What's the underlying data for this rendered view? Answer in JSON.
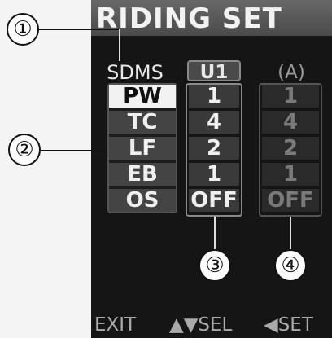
{
  "header": {
    "title": "RIDING SET"
  },
  "columns": {
    "row_header": "SDMS",
    "user_mode": "U1",
    "preset": "(A)"
  },
  "rows": [
    {
      "label": "PW",
      "user_value": "1",
      "preset_value": "1"
    },
    {
      "label": "TC",
      "user_value": "4",
      "preset_value": "4"
    },
    {
      "label": "LF",
      "user_value": "2",
      "preset_value": "2"
    },
    {
      "label": "EB",
      "user_value": "1",
      "preset_value": "1"
    },
    {
      "label": "OS",
      "user_value": "OFF",
      "preset_value": "OFF"
    }
  ],
  "footer": {
    "exit": "EXIT",
    "sel": "▲▼SEL",
    "set": "◀SET"
  },
  "callouts": {
    "c1": "①",
    "c2": "②",
    "c3": "③",
    "c4": "④"
  },
  "colors": {
    "screen_bg": "#151515",
    "header_bg": "#5a5a5a",
    "selected_row_bg": "#f2f2f2"
  }
}
